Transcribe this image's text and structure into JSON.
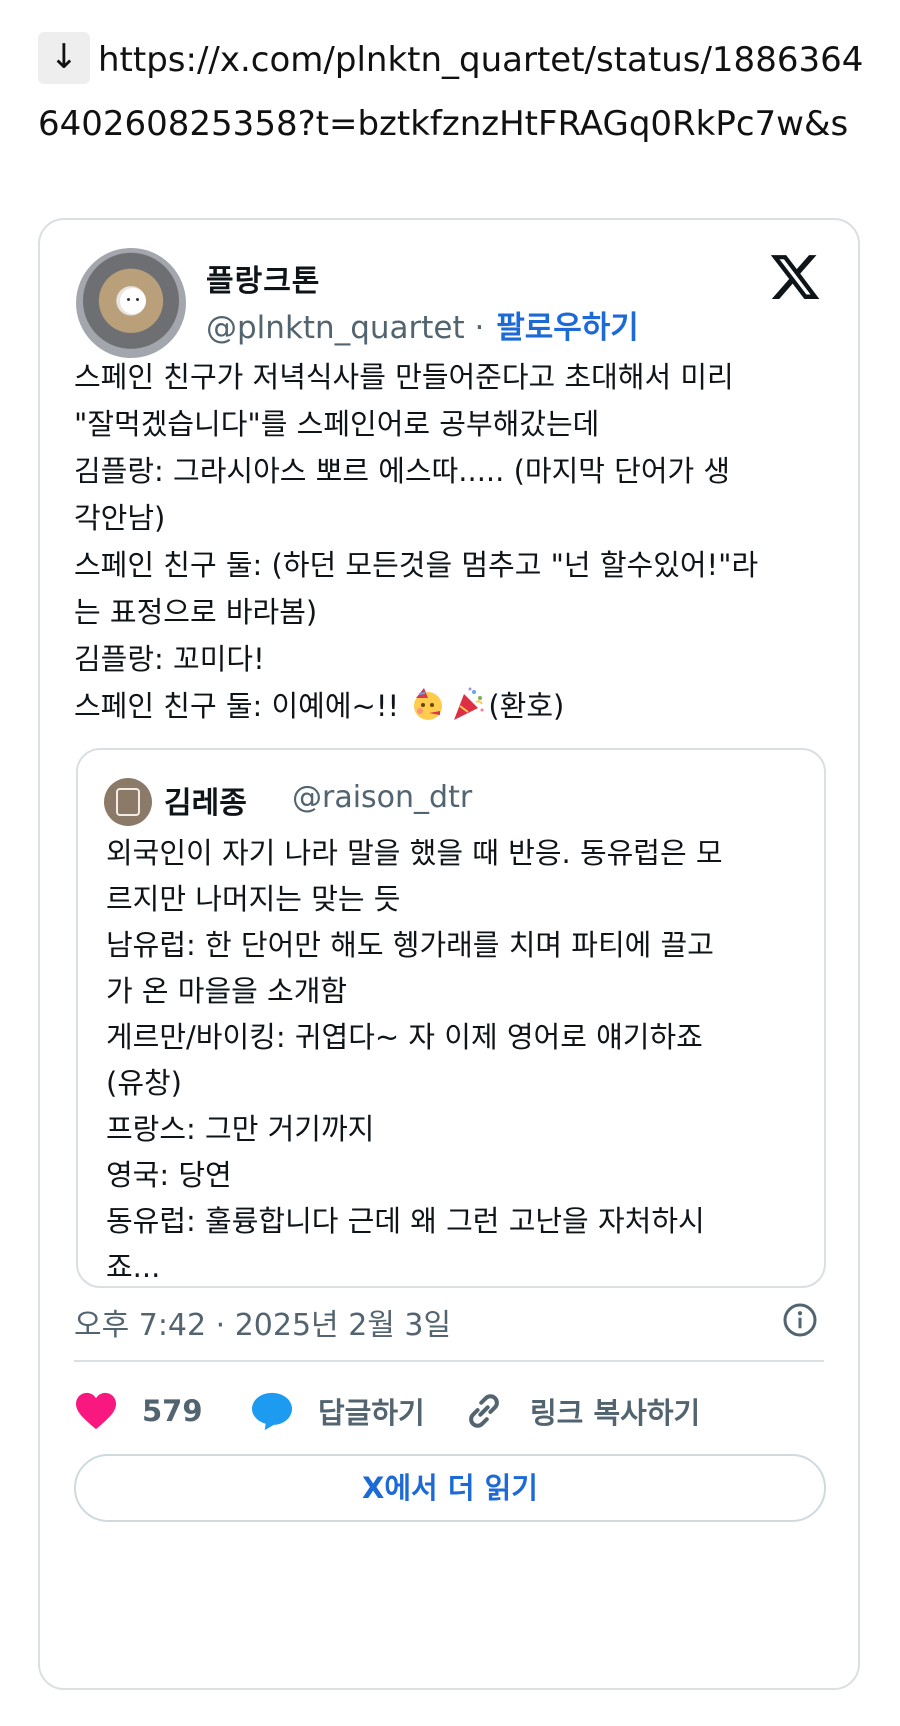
{
  "url": {
    "arrow": "↓",
    "text": "https://x.com/plnktn_quartet/status/1886364640260825358?t=bztkfznzHtFRAGq0RkPc7w&s"
  },
  "tweet": {
    "author_name": "플랑크톤",
    "author_handle": "@plnktn_quartet",
    "separator": " · ",
    "follow_label": "팔로우하기",
    "lines": [
      "스페인 친구가 저녁식사를 만들어준다고 초대해서 미리",
      "\"잘먹겠습니다\"를 스페인어로 공부해갔는데",
      "김플랑: 그라시아스 뽀르 에스따..... (마지막 단어가 생",
      "각안남)",
      "스페인 친구 둘: (하던 모든것을 멈추고 \"넌 할수있어!\"라",
      "는 표정으로 바라봄)",
      "김플랑: 꼬미다!"
    ],
    "last_line_prefix": "스페인 친구 둘: 이예에~!! ",
    "last_line_suffix": "(환호)",
    "emojis": [
      "partying-face-icon",
      "party-popper-icon"
    ],
    "timestamp": "오후 7:42 · 2025년 2월 3일",
    "likes": "579",
    "reply_label": "답글하기",
    "copy_link_label": "링크 복사하기",
    "read_more_label": "X에서 더 읽기"
  },
  "quote": {
    "author_name": "김레종",
    "author_handle": "@raison_dtr",
    "lines": [
      "외국인이 자기 나라 말을 했을 때 반응. 동유럽은 모",
      "르지만 나머지는 맞는 듯",
      "남유럽: 한 단어만 해도 헹가래를 치며 파티에 끌고",
      "가 온 마을을 소개함",
      "게르만/바이킹: 귀엽다~ 자 이제 영어로 얘기하죠",
      "(유창)",
      "프랑스: 그만 거기까지",
      "영국: 당연",
      "동유럽: 훌륭합니다 근데 왜 그런 고난을 자처하시",
      "죠..."
    ]
  },
  "colors": {
    "link_blue": "#1d6ad6",
    "like_pink": "#f91880",
    "reply_blue": "#1d9bf0",
    "muted": "#536471",
    "border": "#dadfe3"
  }
}
